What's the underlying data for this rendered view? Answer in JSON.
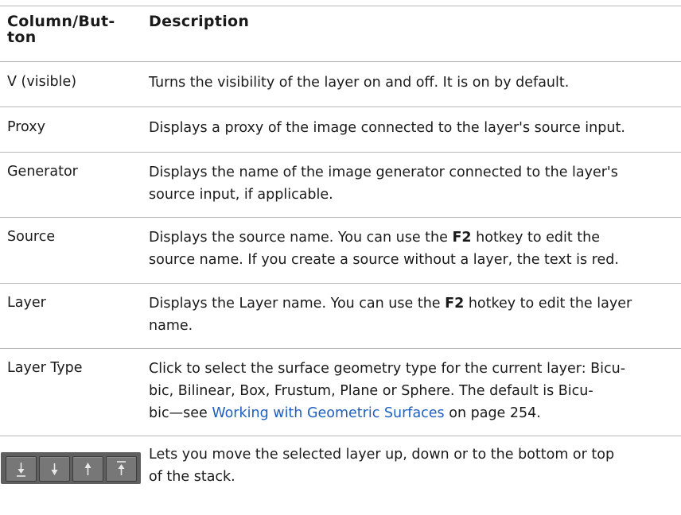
{
  "header": {
    "col1_line1": "Column/But-",
    "col1_line2": "ton",
    "col2": "Description"
  },
  "rows": [
    {
      "name": "V (visible)",
      "desc": "Turns the visibility of the layer on and off. It is on by default."
    },
    {
      "name": "Proxy",
      "desc": "Displays a proxy of the image connected to the layer's source input."
    },
    {
      "name": "Generator",
      "desc1": "Displays the name of the image generator connected to the layer's",
      "desc2": "source input, if applicable."
    },
    {
      "name": "Source",
      "desc1a": "Displays the source name. You can use the ",
      "hotkey": "F2",
      "desc1b": " hotkey to edit the",
      "desc2": "source name. If you create a source without a layer, the text is red."
    },
    {
      "name": "Layer",
      "desc1a": "Displays the Layer name. You can use the ",
      "hotkey": "F2",
      "desc1b": " hotkey to edit the layer",
      "desc2": "name."
    },
    {
      "name": "Layer Type",
      "desc1": "Click to select the surface geometry type for the current layer: Bicu-",
      "desc2": "bic, Bilinear, Box, Frustum, Plane or Sphere. The default is Bicu-",
      "desc3a": "bic—see ",
      "link": "Working with Geometric Surfaces",
      "desc3b": " on page 254."
    },
    {
      "desc1": "Lets you move the selected layer up, down or to the bottom or top",
      "desc2": "of the stack.",
      "buttons": [
        "move-to-bottom-icon",
        "move-down-icon",
        "move-up-icon",
        "move-to-top-icon"
      ]
    }
  ],
  "colors": {
    "rule": "#b8b8b8",
    "link": "#1f5fbf",
    "button_bar": "#5f5f5f"
  }
}
